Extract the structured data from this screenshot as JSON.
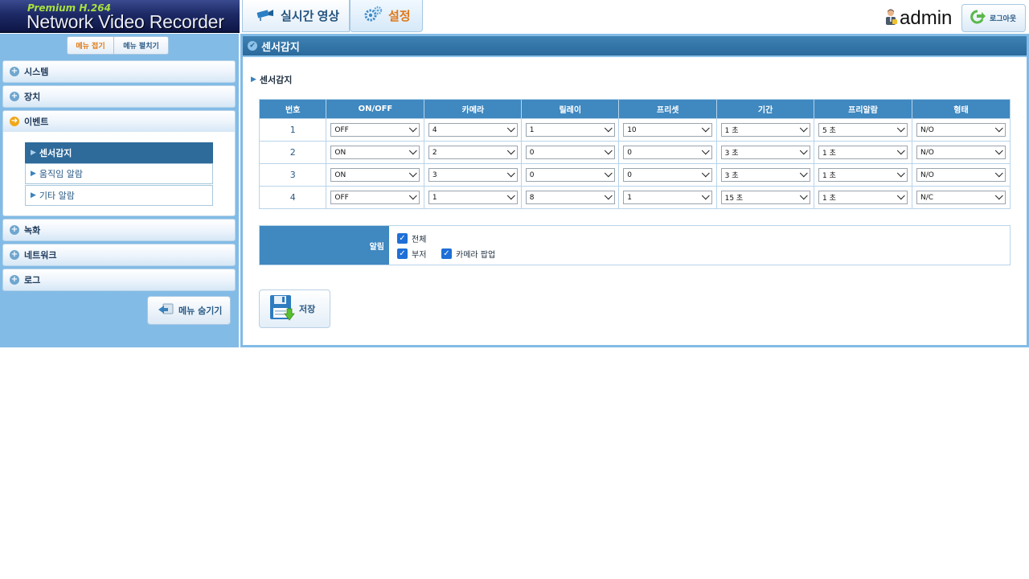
{
  "header": {
    "logo_sub": "Premium H.264",
    "logo_main": "Network Video Recorder",
    "tabs": [
      {
        "label": "실시간 영상",
        "icon": "camera-icon",
        "active": false
      },
      {
        "label": "설정",
        "icon": "gears-icon",
        "active": true
      }
    ],
    "username": "admin",
    "logout_label": "로그아웃"
  },
  "sidebar": {
    "collapse_label": "메뉴 접기",
    "expand_label": "메뉴 펼치기",
    "menu": [
      {
        "label": "시스템"
      },
      {
        "label": "장치"
      },
      {
        "label": "이벤트"
      },
      {
        "label": "녹화"
      },
      {
        "label": "네트워크"
      },
      {
        "label": "로그"
      }
    ],
    "event_submenu": [
      {
        "label": "센서감지"
      },
      {
        "label": "움직임 알람"
      },
      {
        "label": "기타 알람"
      }
    ],
    "hide_menu_label": "메뉴 숨기기"
  },
  "content": {
    "title": "센서감지",
    "section_title": "센서감지",
    "table": {
      "headers": [
        "번호",
        "ON/OFF",
        "카메라",
        "릴레이",
        "프리셋",
        "기간",
        "프리알람",
        "형태"
      ],
      "rows": [
        {
          "no": "1",
          "onoff": "OFF",
          "camera": "4",
          "relay": "1",
          "preset": "10",
          "duration": "1 초",
          "prealarm": "5 초",
          "type": "N/O"
        },
        {
          "no": "2",
          "onoff": "ON",
          "camera": "2",
          "relay": "0",
          "preset": "0",
          "duration": "3 초",
          "prealarm": "1 초",
          "type": "N/O"
        },
        {
          "no": "3",
          "onoff": "ON",
          "camera": "3",
          "relay": "0",
          "preset": "0",
          "duration": "3 초",
          "prealarm": "1 초",
          "type": "N/O"
        },
        {
          "no": "4",
          "onoff": "OFF",
          "camera": "1",
          "relay": "8",
          "preset": "1",
          "duration": "15 초",
          "prealarm": "1 초",
          "type": "N/C"
        }
      ]
    },
    "alarm": {
      "label": "알림",
      "options": [
        {
          "label": "전체",
          "checked": true
        },
        {
          "label": "부저",
          "checked": true
        },
        {
          "label": "카메라 팝업",
          "checked": true
        }
      ]
    },
    "save_label": "저장"
  }
}
